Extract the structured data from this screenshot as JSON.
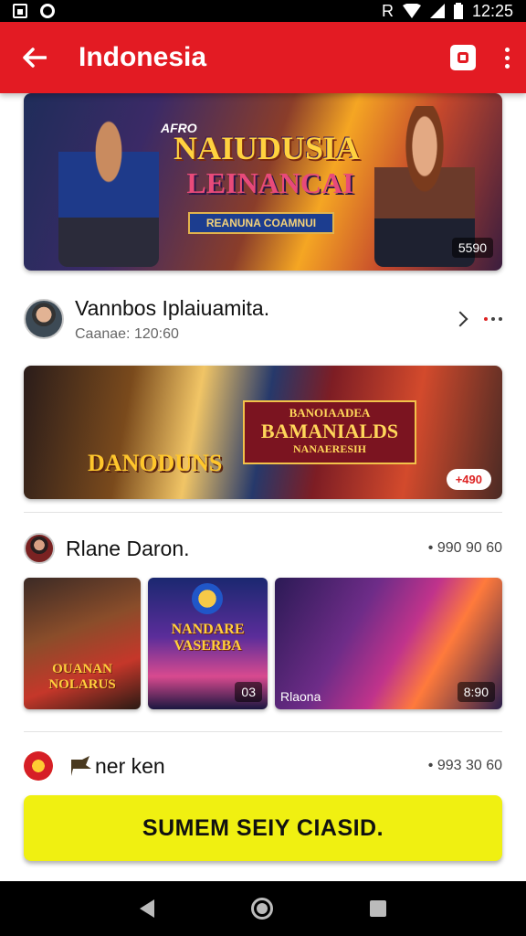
{
  "status_bar": {
    "icons_left": [
      "square-icon",
      "circle-icon"
    ],
    "network": "R",
    "time": "12:25"
  },
  "app_bar": {
    "title": "Indonesia",
    "icons": [
      "back-arrow-icon",
      "search-icon",
      "more-vert-icon"
    ]
  },
  "feed": [
    {
      "banner": {
        "tag": "AFRO",
        "title": "NAIUDUSIA",
        "subtitle": "LEINANCAI",
        "ribbon": "REANUNA COAMNUI",
        "count": "5590"
      },
      "title": "Vannbos Iplaiuamita.",
      "subtitle": "Caanae: 120:60"
    },
    {
      "banner": {
        "title_line_1": "BANOIAADEA",
        "title_line_2": "BAMANIALDS",
        "title_line_3": "NANAERESIH",
        "left_title": "DANODUNS",
        "pill": "+490"
      },
      "title": "Rlane Daron.",
      "meta": "• 990 90 60",
      "thumbnails": [
        {
          "caption": "OUANAN NOLARUS"
        },
        {
          "caption": "NANDARE VASERBA",
          "badge": "03"
        },
        {
          "caption": "Rlaona",
          "badge": "8:90"
        }
      ]
    },
    {
      "title": "ner ken",
      "meta": "• 993 30 60"
    }
  ],
  "cta_button": {
    "label": "SUMEM SEIY CIASID."
  },
  "colors": {
    "app_bar": "#e31b23",
    "cta": "#f0f011"
  }
}
